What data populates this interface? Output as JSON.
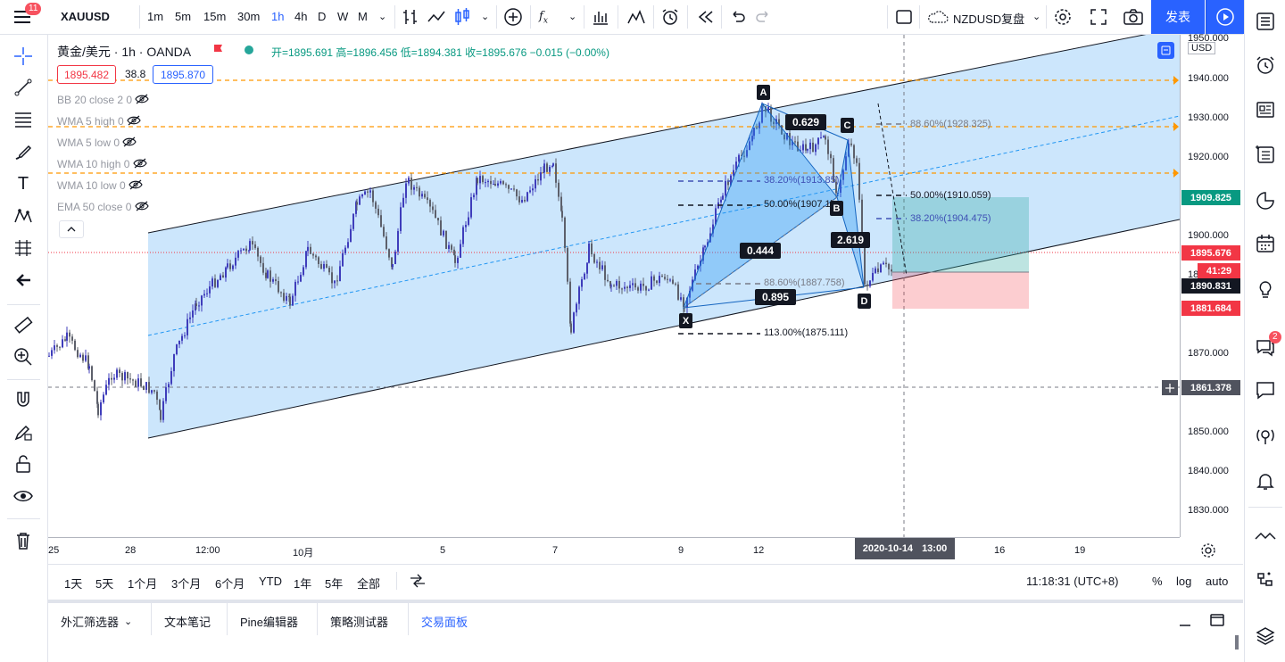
{
  "topbar": {
    "menu_badge": "11",
    "symbol": "XAUUSD",
    "intervals": [
      "1m",
      "5m",
      "15m",
      "30m",
      "1h",
      "4h",
      "D",
      "W",
      "M"
    ],
    "active_interval": "1h",
    "compare_symbol": "NZDUSD复盘",
    "publish_label": "发表"
  },
  "legend": {
    "title": "黄金/美元 · 1h · OANDA",
    "ohlc": "开=1895.691 高=1896.456 低=1894.381 收=1895.676 −0.015 (−0.00%)",
    "bid": "1895.482",
    "spread": "38.8",
    "ask": "1895.870",
    "indicators": [
      "BB 20 close 2 0",
      "WMA 5 high 0",
      "WMA 5 low 0",
      "WMA 10 high 0",
      "WMA 10 low 0",
      "EMA 50 close 0"
    ]
  },
  "price_scale": {
    "currency": "USD",
    "ticks": [
      "1950.000",
      "1940.000",
      "1930.000",
      "1920.000",
      "1910.000",
      "1900.000",
      "1870.000",
      "1850.000",
      "1840.000",
      "1830.000"
    ],
    "partial_tick": "18",
    "labels": {
      "target": "1909.825",
      "last_price": "1895.676",
      "countdown": "41:29",
      "entry": "1890.831",
      "stop": "1881.684",
      "crosshair": "1861.378"
    },
    "colors": {
      "target": "#089981",
      "last_price": "#f23645",
      "countdown": "#f23645",
      "entry": "#131722",
      "stop": "#f23645",
      "crosshair": "#50535e"
    }
  },
  "time_scale": {
    "ticks": [
      "25",
      "28",
      "12:00",
      "10月",
      "5",
      "7",
      "9",
      "12",
      "16",
      "19"
    ],
    "crosshair_date": "2020-10-14",
    "crosshair_time": "13:00"
  },
  "pattern": {
    "points": [
      "X",
      "A",
      "B",
      "C",
      "D"
    ],
    "ratios": [
      "0.629",
      "0.444",
      "2.619",
      "0.895"
    ],
    "fib_levels": [
      "88.60%(1928.325)",
      "38.20%(1913.85)",
      "50.00%(1907.1)",
      "50.00%(1910.059)",
      "38.20%(1904.475)",
      "88.60%(1887.758)",
      "113.00%(1875.111)"
    ]
  },
  "range_bar": {
    "ranges": [
      "1天",
      "5天",
      "1个月",
      "3个月",
      "6个月",
      "YTD",
      "1年",
      "5年",
      "全部"
    ],
    "clock": "11:18:31 (UTC+8)",
    "options": [
      "%",
      "log",
      "auto"
    ]
  },
  "bottom_tabs": [
    "外汇筛选器",
    "文本笔记",
    "Pine编辑器",
    "策略测试器",
    "交易面板"
  ],
  "active_bottom_tab": "交易面板",
  "right_sidebar": {
    "notification_badge": "2"
  }
}
